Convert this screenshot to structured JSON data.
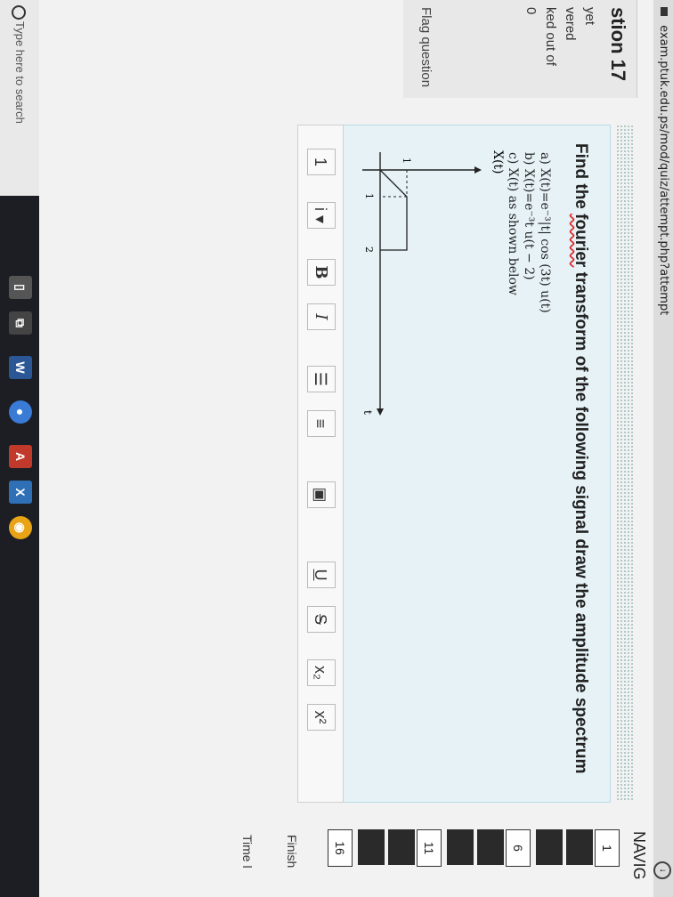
{
  "browser": {
    "url": "exam.ptuk.edu.ps/mod/quiz/attempt.php?attempt"
  },
  "question_info": {
    "number": "stion 17",
    "status": "yet",
    "answered": "vered",
    "marked": "ked out of",
    "marks": "0",
    "flag_label": "Flag question"
  },
  "question": {
    "title_pre": "Find the ",
    "title_word": "fourier",
    "title_post": " transform of the following signal draw the amplitude spectrum",
    "parts": [
      "a)  X(t)=e⁻³|t| cos (3t) u(t)",
      "b)  X(t)=e⁻³t u(t − 2)",
      "c)  X(t) as shown below"
    ],
    "signal_label": "X(t)",
    "axis_t_label": "t",
    "tick_1_y": "1",
    "tick_1_x": "1",
    "tick_2_x": "2"
  },
  "toolbar": {
    "buttons": [
      "1",
      "i ▾",
      "B",
      "I",
      "☰",
      "≡",
      "▣",
      "U",
      "S",
      "x₂",
      "x²"
    ]
  },
  "navigation": {
    "title": "NAVIG",
    "items": [
      "1",
      "6",
      "11",
      "16"
    ],
    "finish_label": "Finish",
    "time_label": "Time l"
  },
  "taskbar": {
    "search_placeholder": "Type here to search",
    "icons": [
      "W",
      "A",
      "X"
    ]
  }
}
